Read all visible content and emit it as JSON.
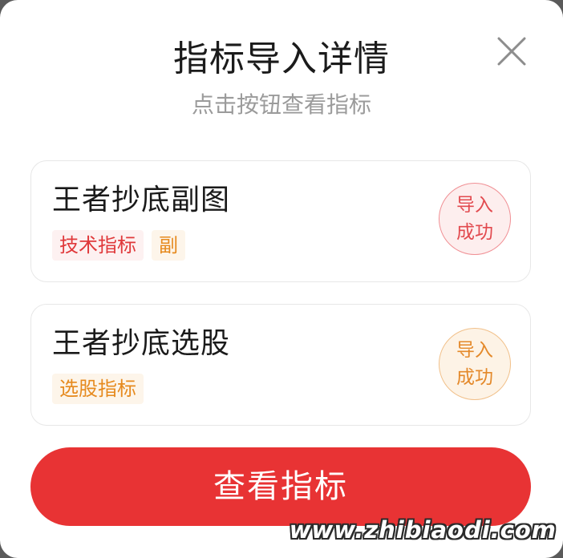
{
  "dialog": {
    "title": "指标导入详情",
    "subtitle": "点击按钮查看指标",
    "close_icon": "close-icon"
  },
  "items": [
    {
      "name": "王者抄底副图",
      "tags": [
        {
          "label": "技术指标",
          "color": "#e0393b"
        },
        {
          "label": "副",
          "color": "#e68a1e"
        }
      ],
      "status": {
        "line1": "导入",
        "line2": "成功",
        "color": "#e24a4f"
      }
    },
    {
      "name": "王者抄底选股",
      "tags": [
        {
          "label": "选股指标",
          "color": "#e68a1e"
        }
      ],
      "status": {
        "line1": "导入",
        "line2": "成功",
        "color": "#e4892a"
      }
    }
  ],
  "action": {
    "label": "查看指标",
    "color": "#e83334"
  },
  "watermark": "www.zhibiaodi.com"
}
